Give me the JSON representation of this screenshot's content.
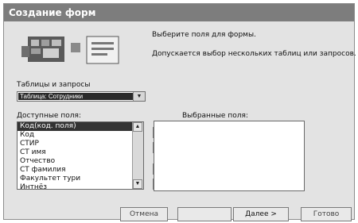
{
  "window": {
    "title": "Создание форм"
  },
  "hints": {
    "line1": "Выберите поля для формы.",
    "line2": "Допускается выбор нескольких таблиц или запросов."
  },
  "tables": {
    "label": "Таблицы и запросы",
    "selected": "Таблица: Сотрудники"
  },
  "available": {
    "label": "Доступные поля:",
    "items": [
      "Код(код. поля)",
      "Код",
      "СТИР",
      "СТ имя",
      "Отчество",
      "СТ фамилия",
      "Факультет тури",
      "Интнёз"
    ]
  },
  "chosen": {
    "label": "Выбранные поля:"
  },
  "move_buttons": {
    "add_one": ">",
    "add_all": ">>",
    "remove_one": "",
    "remove_all": ""
  },
  "footer": {
    "cancel": "Отмена",
    "back": "",
    "next": "Далее >",
    "finish": "Готово"
  }
}
